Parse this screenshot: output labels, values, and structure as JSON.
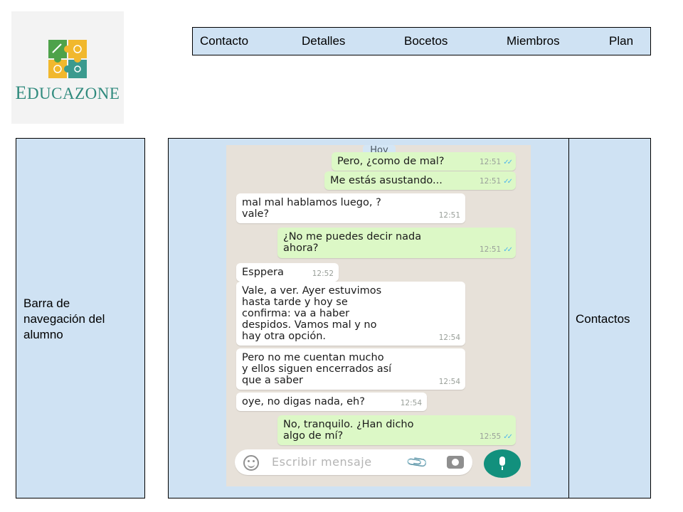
{
  "logo": {
    "text_cap": "E",
    "text_rest": "DUCAZONE"
  },
  "topnav": {
    "items": [
      "Contacto",
      "Detalles",
      "Bocetos",
      "Miembros",
      "Plan"
    ]
  },
  "sidebar": {
    "label": "Barra de navegación del alumno"
  },
  "contacts_panel": {
    "label": "Contactos"
  },
  "chat": {
    "day_badge": "Hoy",
    "messages": [
      {
        "dir": "out",
        "text": "Pero, ¿como de mal?",
        "time": "12:51",
        "status": "read"
      },
      {
        "dir": "out",
        "text": "Me estás asustando...",
        "time": "12:51",
        "status": "read"
      },
      {
        "dir": "in",
        "text": "mal mal hablamos luego, ?\nvale?",
        "time": "12:51"
      },
      {
        "dir": "out",
        "text": "¿No me puedes decir nada\nahora?",
        "time": "12:51",
        "status": "read"
      },
      {
        "dir": "in",
        "text": "Esppera",
        "time": "12:52"
      },
      {
        "dir": "in",
        "text": "Vale, a ver. Ayer estuvimos\nhasta tarde y hoy se\nconfirma: va a haber\ndespidos. Vamos mal y no\nhay otra opción.",
        "time": "12:54"
      },
      {
        "dir": "in",
        "text": "Pero no me cuentan mucho\ny ellos siguen encerrados así\nque a saber",
        "time": "12:54"
      },
      {
        "dir": "in",
        "text": "oye, no digas nada, eh?",
        "time": "12:54"
      },
      {
        "dir": "out",
        "text": "No, tranquilo. ¿Han dicho\nalgo de mí?",
        "time": "12:55",
        "status": "read"
      }
    ],
    "input_placeholder": "Escribir mensaje",
    "icons": [
      "emoji-icon",
      "attach-icon",
      "camera-icon",
      "mic-icon"
    ]
  },
  "colors": {
    "panel_bg": "#cfe2f3",
    "chat_bg": "#e7e1d9",
    "bubble_out": "#dcf8c6",
    "bubble_in": "#ffffff",
    "mic_button": "#12907d",
    "logo_text": "#2f8a7d"
  }
}
